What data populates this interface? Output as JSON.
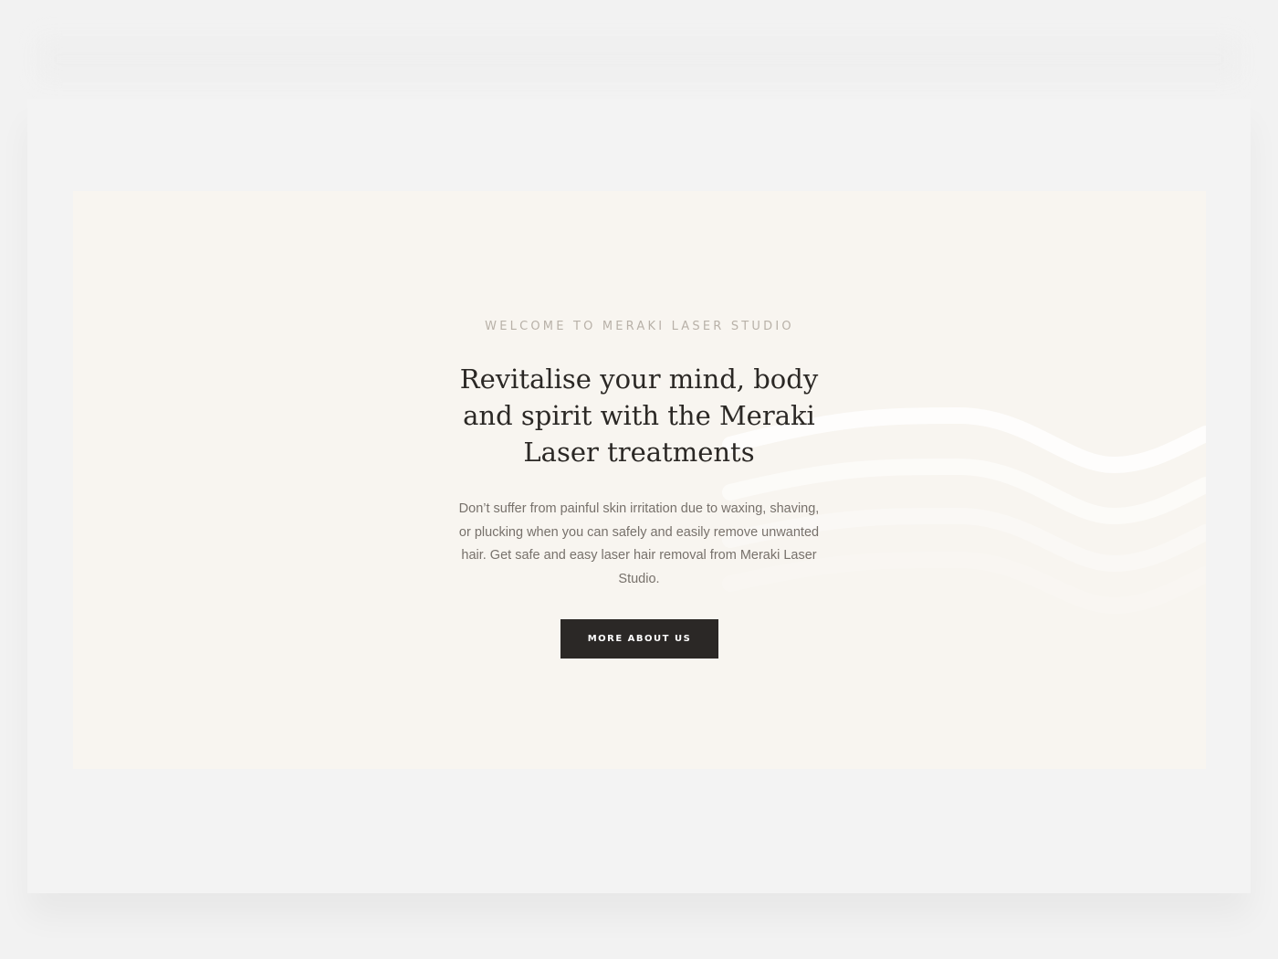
{
  "hero": {
    "eyebrow": "WELCOME TO MERAKI LASER STUDIO",
    "headline": "Revitalise your mind, body and spirit with the Meraki Laser treatments",
    "body": "Don’t suffer from painful skin irritation due to waxing, shaving, or plucking when you can safely and easily remove unwanted hair. Get safe and easy laser hair removal from Meraki Laser Studio.",
    "button_label": "MORE ABOUT US"
  },
  "colors": {
    "page_background": "#f2f2f2",
    "hero_background": "#f8f5f0",
    "heading": "#2b2825",
    "eyebrow": "#b8b1a8",
    "body_text": "#77716b",
    "button_background": "#2b2826",
    "button_text": "#ffffff",
    "wave_highlight": "#ffffff"
  },
  "decorations": {
    "background_motif": "wave-pattern"
  }
}
